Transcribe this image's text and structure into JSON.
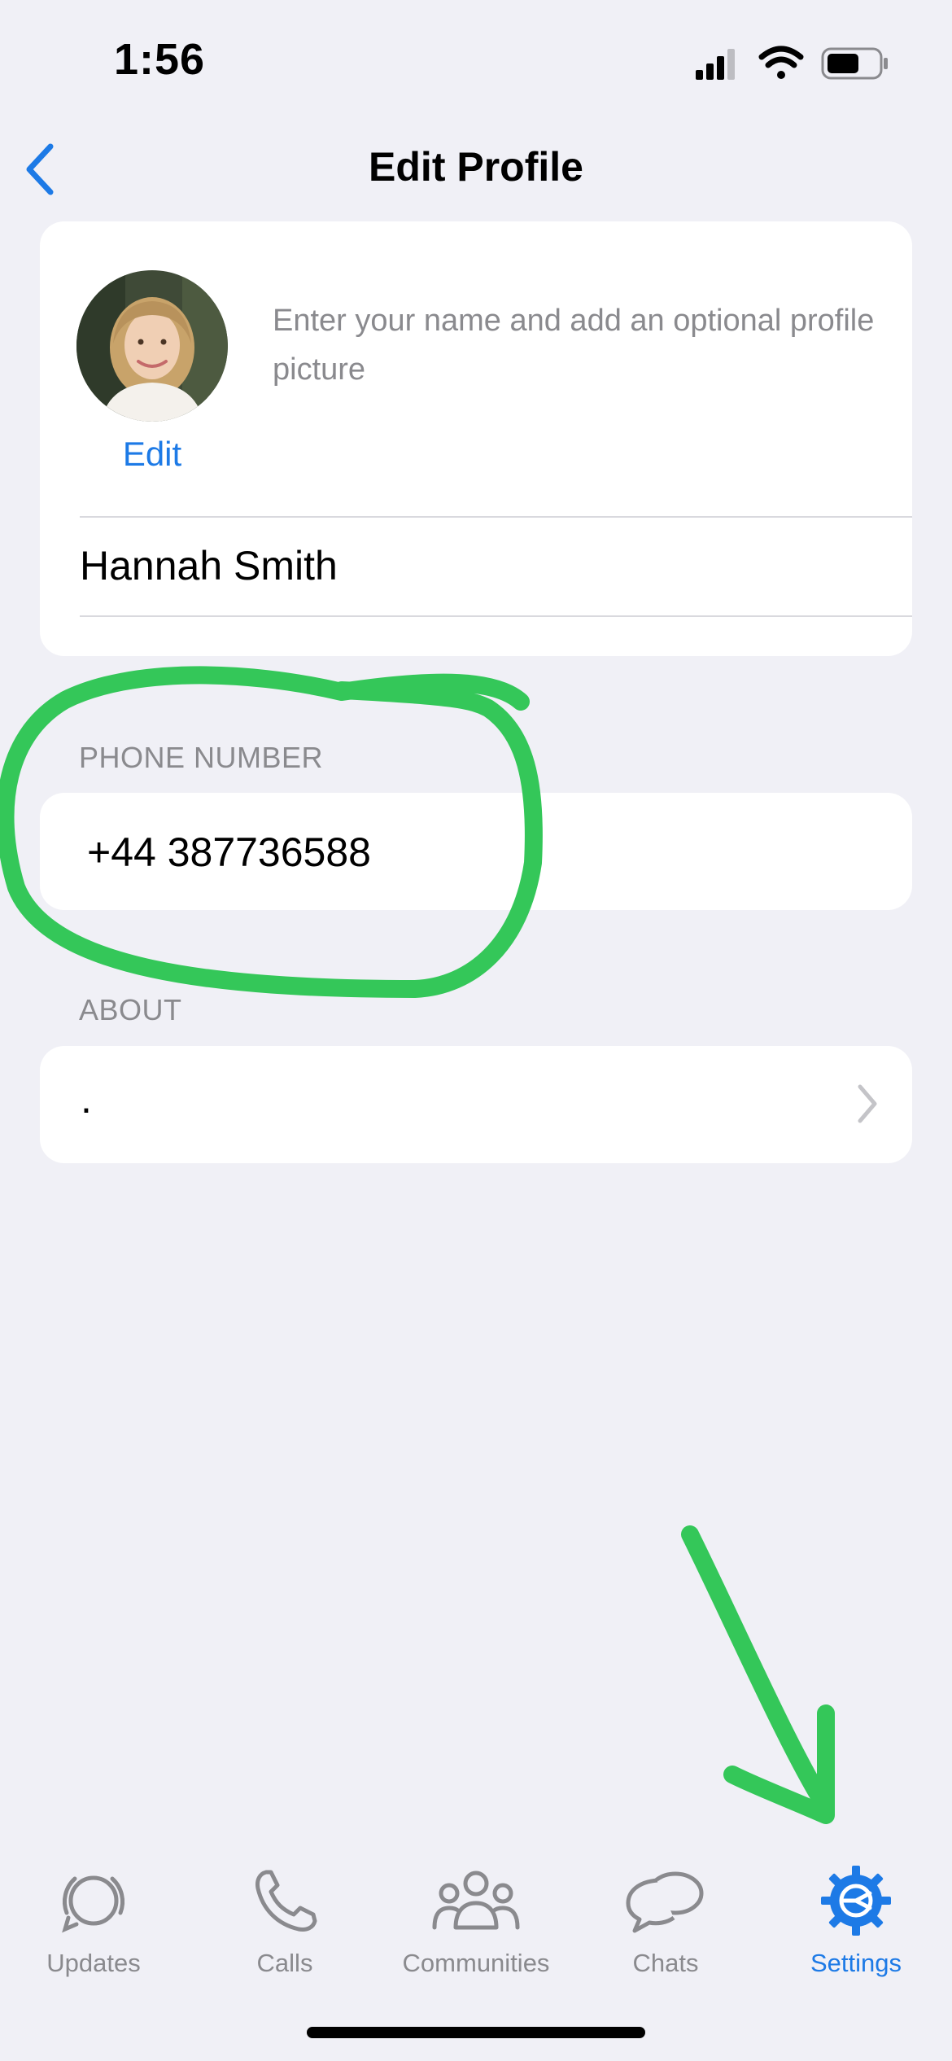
{
  "status_bar": {
    "time": "1:56",
    "icons": [
      "cellular-signal-icon",
      "wifi-icon",
      "battery-icon"
    ]
  },
  "nav": {
    "title": "Edit Profile",
    "back_icon": "chevron-left-icon"
  },
  "profile": {
    "edit_label": "Edit",
    "hint": "Enter your name and add an optional profile picture",
    "name": "Hannah Smith"
  },
  "phone": {
    "label": "PHONE NUMBER",
    "value": "+44 387736588"
  },
  "about": {
    "label": "ABOUT",
    "value": "."
  },
  "tab_bar": {
    "tabs": [
      {
        "label": "Updates",
        "icon": "updates-icon",
        "active": false
      },
      {
        "label": "Calls",
        "icon": "phone-icon",
        "active": false
      },
      {
        "label": "Communities",
        "icon": "communities-icon",
        "active": false
      },
      {
        "label": "Chats",
        "icon": "chats-icon",
        "active": false
      },
      {
        "label": "Settings",
        "icon": "gear-icon",
        "active": true
      }
    ]
  },
  "colors": {
    "accent": "#1d7ae6",
    "background": "#f0f0f6",
    "annotation": "#34c759"
  }
}
